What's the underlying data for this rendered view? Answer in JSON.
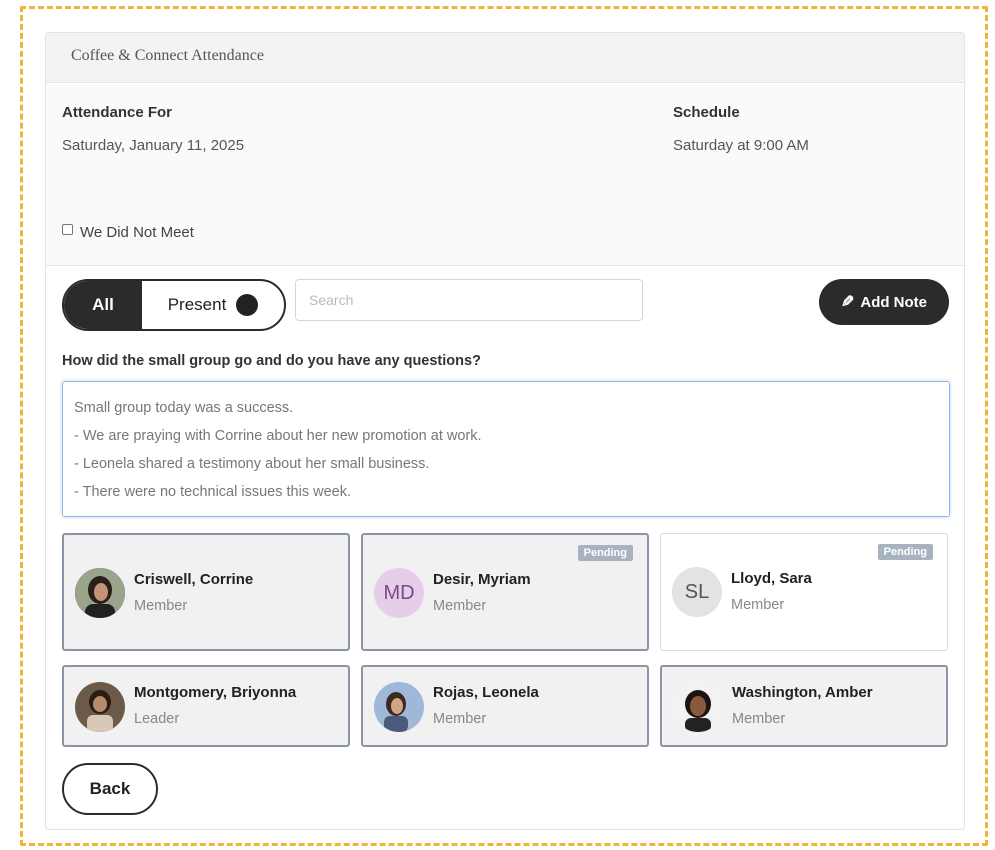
{
  "panel": {
    "title": "Coffee & Connect Attendance"
  },
  "attendance": {
    "label": "Attendance For",
    "date": "Saturday, January 11, 2025",
    "schedule_label": "Schedule",
    "schedule_value": "Saturday at 9:00 AM",
    "did_not_meet_label": "We Did Not Meet",
    "did_not_meet_checked": false
  },
  "filters": {
    "all_label": "All",
    "present_label": "Present",
    "selected": "All",
    "search_placeholder": "Search",
    "add_note_label": "Add Note",
    "add_note_icon": "pencil-icon"
  },
  "notes": {
    "question": "How did the small group go and do you have any questions?",
    "text": "Small group today was a success.\n- We are praying with Corrine about her new promotion at work.\n- Leonela shared a testimony about her small business.\n- There were no technical issues this week."
  },
  "members": [
    {
      "name": "Criswell, Corrine",
      "role": "Member",
      "avatar": "photo",
      "present": true,
      "badge": ""
    },
    {
      "name": "Desir, Myriam",
      "role": "Member",
      "avatar": "initials",
      "initials": "MD",
      "present": true,
      "badge": "Pending"
    },
    {
      "name": "Lloyd, Sara",
      "role": "Member",
      "avatar": "initials",
      "initials": "SL",
      "present": false,
      "badge": "Pending"
    },
    {
      "name": "Montgomery, Briyonna",
      "role": "Leader",
      "avatar": "photo",
      "present": true,
      "badge": ""
    },
    {
      "name": "Rojas, Leonela",
      "role": "Member",
      "avatar": "photo",
      "present": true,
      "badge": ""
    },
    {
      "name": "Washington, Amber",
      "role": "Member",
      "avatar": "photo",
      "present": true,
      "badge": ""
    }
  ],
  "actions": {
    "back_label": "Back"
  },
  "colors": {
    "accent_dark": "#2b2b2b",
    "frame_dashed": "#f0b43a",
    "badge_pending": "#a7b4bf",
    "avatar_md_bg": "#e6cdea",
    "avatar_sl_bg": "#e3e3e3"
  }
}
